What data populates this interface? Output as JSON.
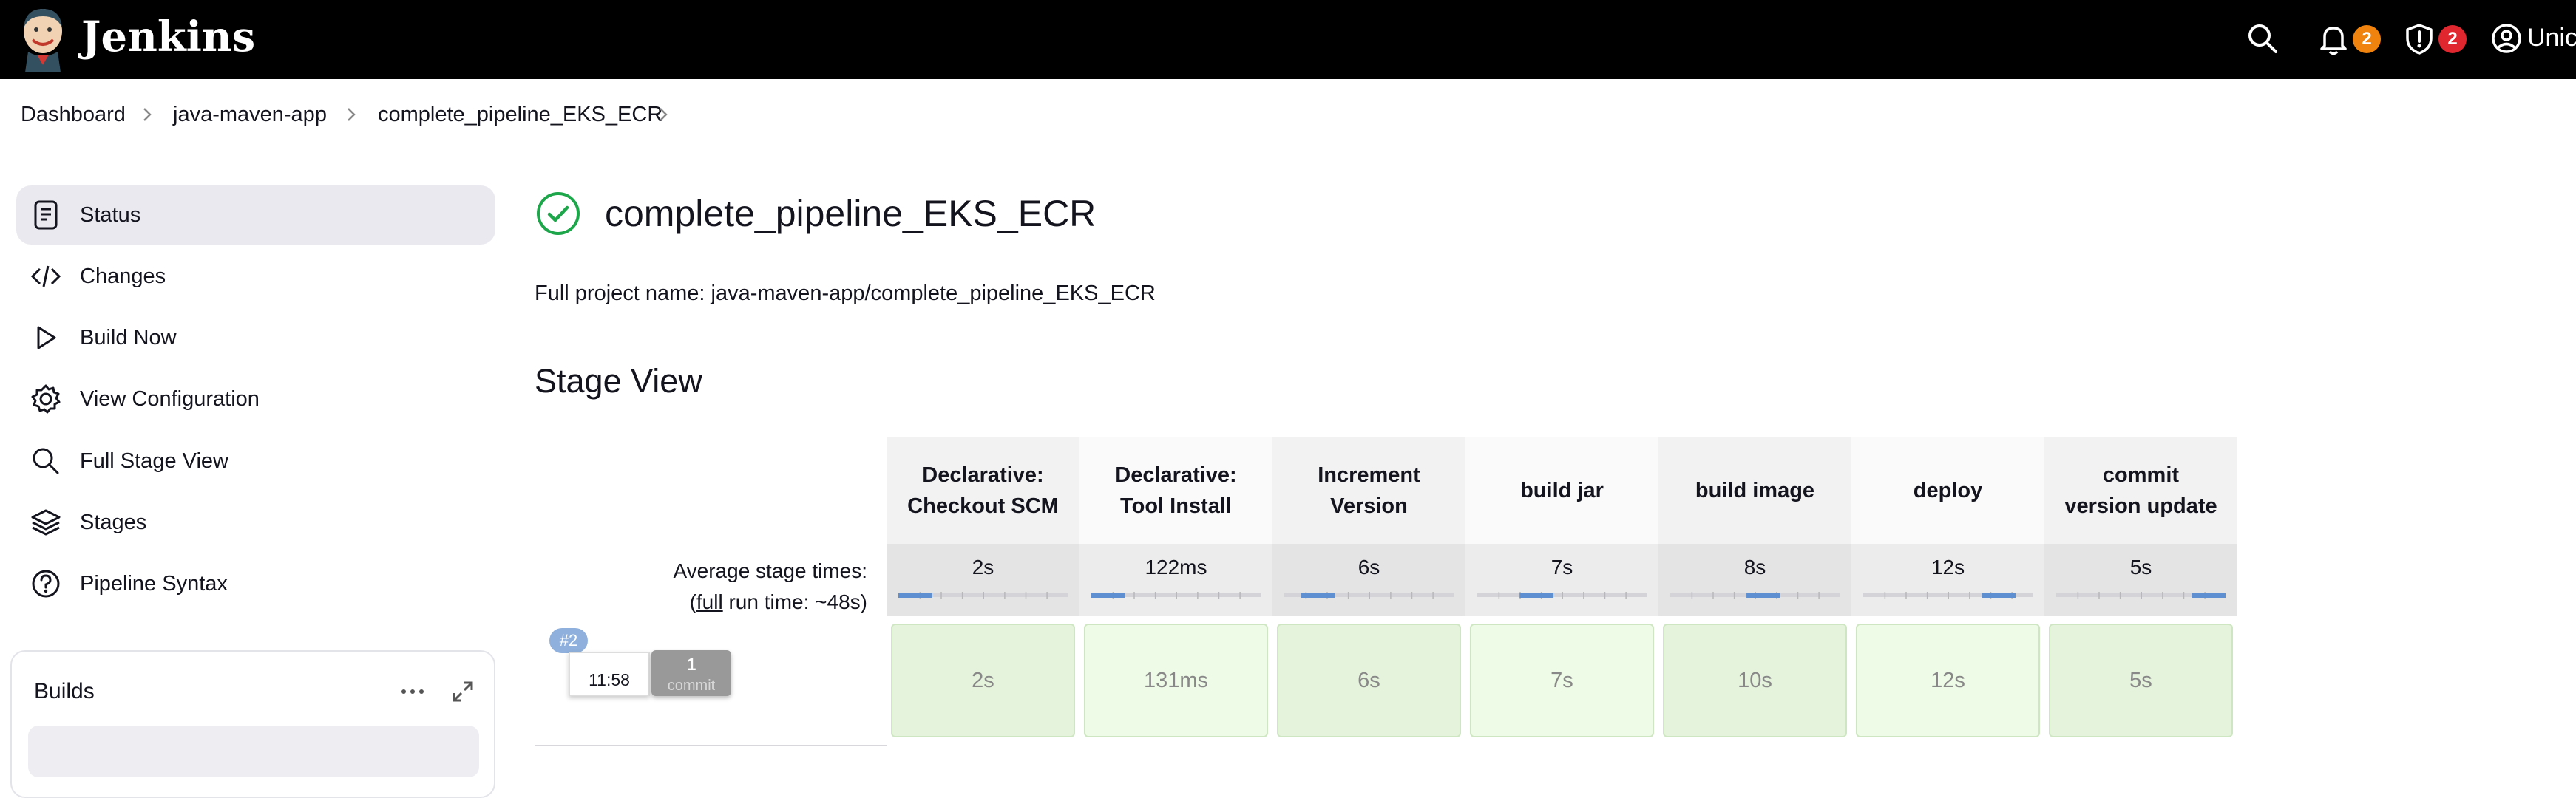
{
  "header": {
    "brand": "Jenkins",
    "notifications_count": "2",
    "security_count": "2",
    "user_name": "Unicorn",
    "colors": {
      "background": "#000000",
      "notif_badge": "#f0830d",
      "security_badge": "#e0272f"
    }
  },
  "breadcrumbs": [
    "Dashboard",
    "java-maven-app",
    "complete_pipeline_EKS_ECR"
  ],
  "sidebar": {
    "items": [
      {
        "label": "Status",
        "icon": "notepad-icon",
        "active": true
      },
      {
        "label": "Changes",
        "icon": "code-icon"
      },
      {
        "label": "Build Now",
        "icon": "play-icon"
      },
      {
        "label": "View Configuration",
        "icon": "gear-icon"
      },
      {
        "label": "Full Stage View",
        "icon": "search-icon"
      },
      {
        "label": "Stages",
        "icon": "layers-icon"
      },
      {
        "label": "Pipeline Syntax",
        "icon": "question-icon"
      }
    ],
    "builds": {
      "title": "Builds"
    }
  },
  "main": {
    "title": "complete_pipeline_EKS_ECR",
    "status": "success",
    "full_project_name": "Full project name: java-maven-app/complete_pipeline_EKS_ECR",
    "stage_view_title": "Stage View",
    "avg_label": "Average stage times:",
    "run_time_prefix": "(",
    "run_time_link": "full",
    "run_time_suffix": " run time: ~48s)",
    "stages": [
      {
        "name_line1": "Declarative:",
        "name_line2": "Checkout SCM",
        "avg": "2s",
        "run": "2s",
        "progress": 0.08
      },
      {
        "name_line1": "Declarative:",
        "name_line2": "Tool Install",
        "avg": "122ms",
        "run": "131ms",
        "progress": 0.02
      },
      {
        "name_line1": "Increment",
        "name_line2": "Version",
        "avg": "6s",
        "run": "6s",
        "progress": 0.2
      },
      {
        "name_line1": "build jar",
        "name_line2": "",
        "avg": "7s",
        "run": "7s",
        "progress": 0.35
      },
      {
        "name_line1": "build image",
        "name_line2": "",
        "avg": "8s",
        "run": "10s",
        "progress": 0.55
      },
      {
        "name_line1": "deploy",
        "name_line2": "",
        "avg": "12s",
        "run": "12s",
        "progress": 0.8
      },
      {
        "name_line1": "commit",
        "name_line2": "version update",
        "avg": "5s",
        "run": "5s",
        "progress": 0.95
      }
    ],
    "run": {
      "number": "#2",
      "time": "11:58",
      "commits": "1",
      "commits_label": "commit"
    }
  }
}
